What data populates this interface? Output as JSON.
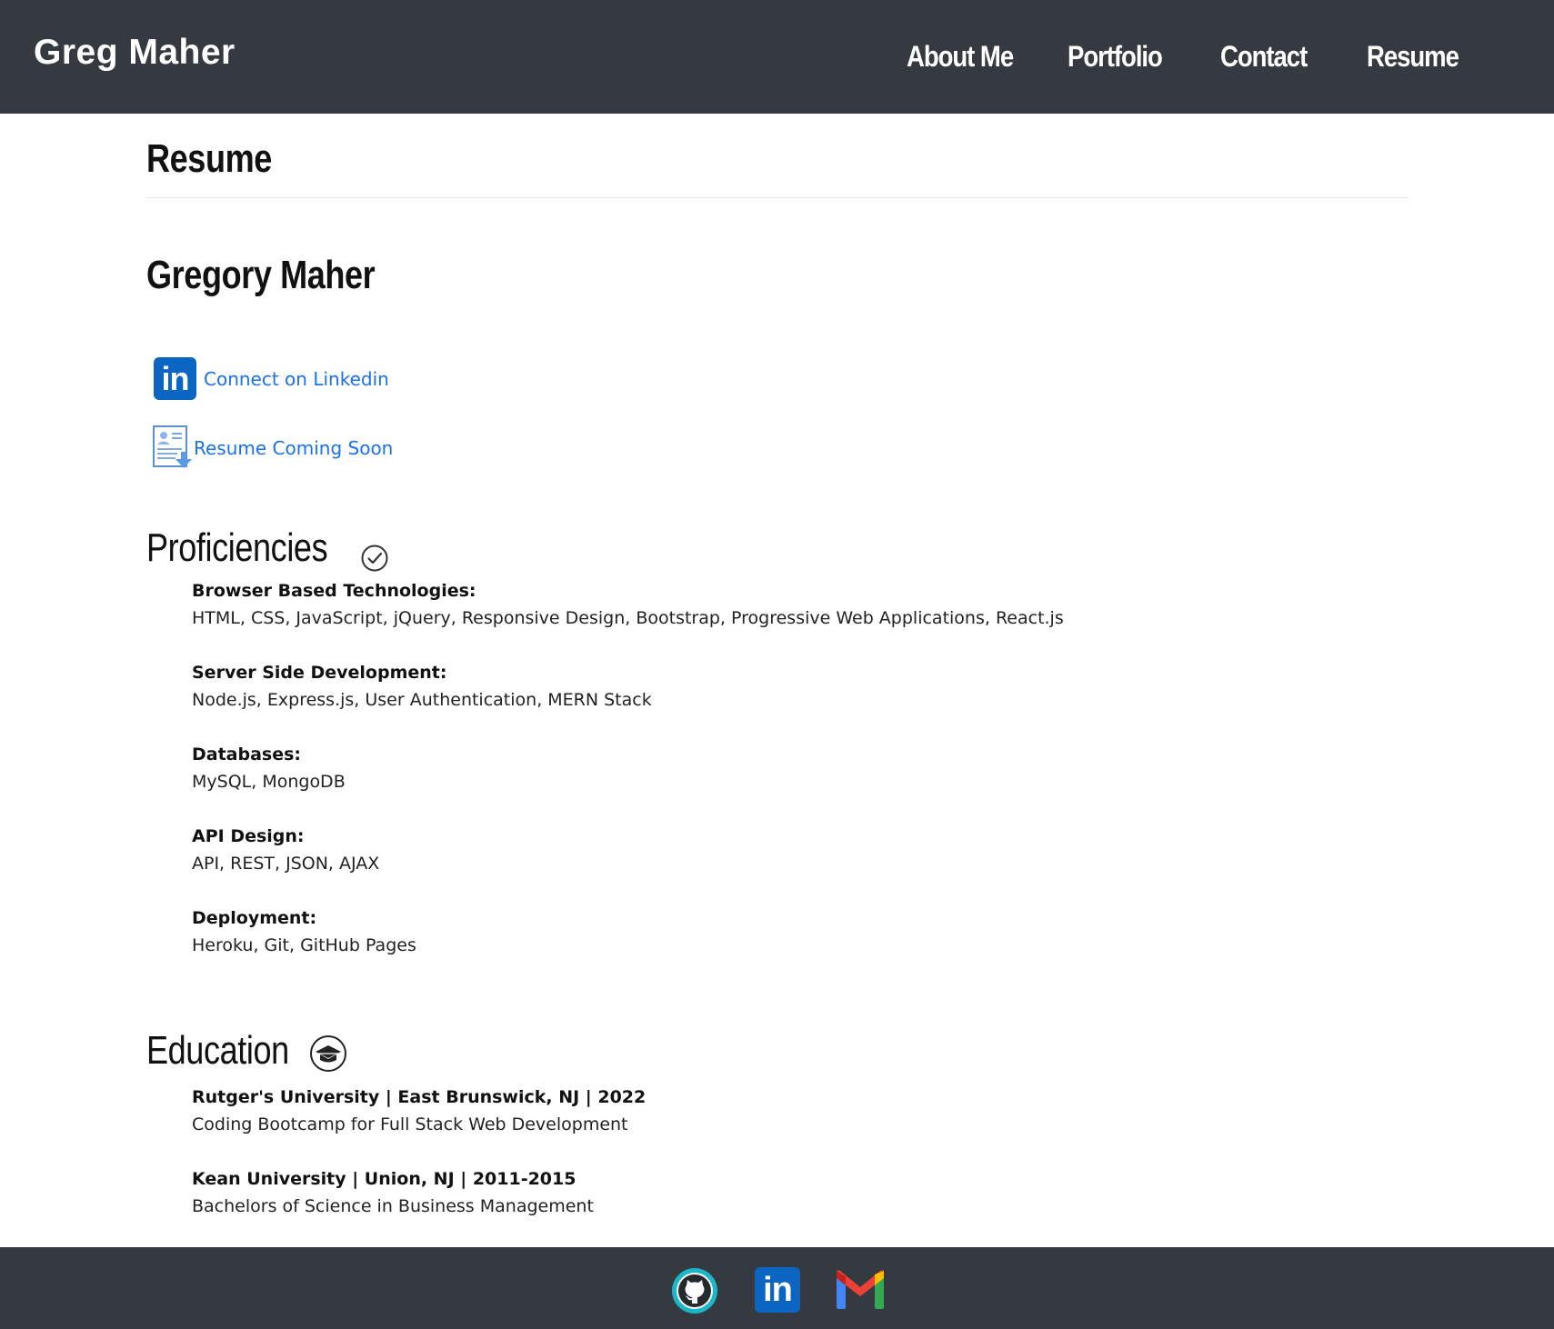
{
  "header": {
    "brand": "Greg Maher",
    "nav": [
      {
        "label": "About Me"
      },
      {
        "label": "Portfolio"
      },
      {
        "label": "Contact"
      },
      {
        "label": "Resume"
      }
    ]
  },
  "page": {
    "title": "Resume",
    "name": "Gregory Maher",
    "links": {
      "linkedin": "Connect on Linkedin",
      "resume": "Resume Coming Soon"
    }
  },
  "proficiencies": {
    "title": "Proficiencies",
    "items": [
      {
        "head": "Browser Based Technologies:",
        "body": "HTML, CSS, JavaScript, jQuery, Responsive Design, Bootstrap, Progressive Web Applications, React.js"
      },
      {
        "head": "Server Side Development:",
        "body": "Node.js, Express.js, User Authentication, MERN Stack"
      },
      {
        "head": "Databases:",
        "body": "MySQL, MongoDB"
      },
      {
        "head": "API Design:",
        "body": "API, REST, JSON, AJAX"
      },
      {
        "head": "Deployment:",
        "body": "Heroku, Git, GitHub Pages"
      }
    ]
  },
  "education": {
    "title": "Education",
    "items": [
      {
        "head": "Rutger's University | East Brunswick, NJ | 2022",
        "body": "Coding Bootcamp for Full Stack Web Development"
      },
      {
        "head": "Kean University | Union, NJ | 2011-2015",
        "body": "Bachelors of Science in Business Management"
      }
    ]
  },
  "icons": {
    "linkedin_text": "in",
    "colors": {
      "header_bg": "#343a40",
      "link_blue": "#1a73e8",
      "linkedin_blue": "#0a66c2",
      "github_teal": "#1ab7c8"
    }
  }
}
